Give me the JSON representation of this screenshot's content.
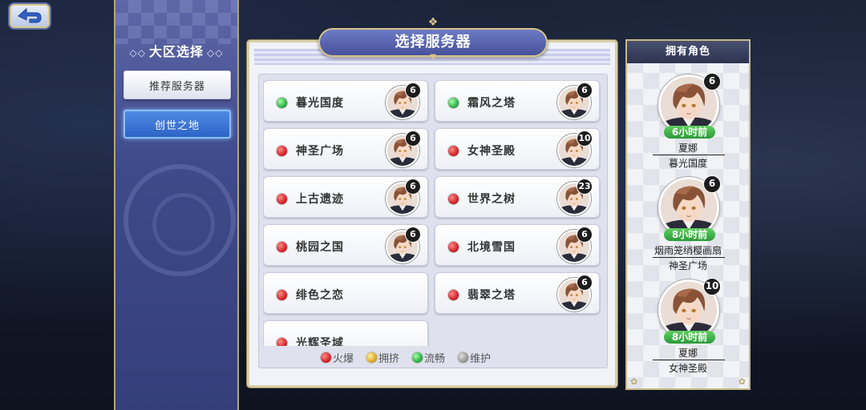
{
  "back_icon": "back-arrow-icon",
  "left_panel": {
    "title": "大区选择",
    "ornament": "◇◇",
    "buttons": [
      {
        "label": "推荐服务器",
        "state": "normal"
      },
      {
        "label": "创世之地",
        "state": "selected"
      }
    ]
  },
  "main": {
    "title": "选择服务器",
    "servers": [
      {
        "name": "暮光国度",
        "status": "green",
        "level": "6"
      },
      {
        "name": "霜风之塔",
        "status": "green",
        "level": "6"
      },
      {
        "name": "神圣广场",
        "status": "red",
        "level": "6"
      },
      {
        "name": "女神圣殿",
        "status": "red",
        "level": "10"
      },
      {
        "name": "上古遗迹",
        "status": "red",
        "level": "6"
      },
      {
        "name": "世界之树",
        "status": "red",
        "level": "23"
      },
      {
        "name": "桃园之国",
        "status": "red",
        "level": "6"
      },
      {
        "name": "北境雪国",
        "status": "red",
        "level": "6"
      },
      {
        "name": "绯色之恋",
        "status": "red",
        "level": ""
      },
      {
        "name": "翡翠之塔",
        "status": "red",
        "level": "6"
      },
      {
        "name": "光辉圣域",
        "status": "red",
        "level": ""
      }
    ],
    "legend": [
      {
        "label": "火爆",
        "color": "red"
      },
      {
        "label": "拥挤",
        "color": "yellow"
      },
      {
        "label": "流畅",
        "color": "green"
      },
      {
        "label": "维护",
        "color": "gray"
      }
    ]
  },
  "roles_panel": {
    "title": "拥有角色",
    "roles": [
      {
        "level": "6",
        "time": "6小时前",
        "name": "夏娜",
        "server": "暮光国度"
      },
      {
        "level": "6",
        "time": "8小时前",
        "name": "烟雨笼绡樱画扇",
        "server": "神圣广场"
      },
      {
        "level": "10",
        "time": "8小时前",
        "name": "夏娜",
        "server": "女神圣殿"
      }
    ]
  },
  "colors": {
    "panel_blue": "#46519a",
    "gold": "#d7c48b",
    "selected_blue": "#2d63c6"
  }
}
